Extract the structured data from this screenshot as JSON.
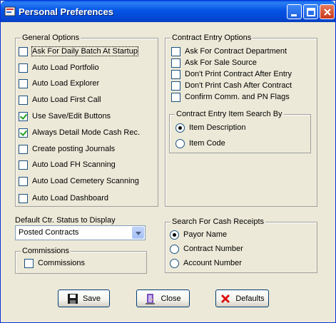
{
  "window": {
    "title": "Personal Preferences",
    "colors": {
      "titlebar": "#0554e4",
      "face": "#ece9d8"
    }
  },
  "general_options": {
    "title": "General Options",
    "items": [
      {
        "label": "Ask For Daily Batch At Startup",
        "checked": false
      },
      {
        "label": "Auto Load Portfolio",
        "checked": false
      },
      {
        "label": "Auto Load Explorer",
        "checked": false
      },
      {
        "label": "Auto Load First Call",
        "checked": false
      },
      {
        "label": "Use Save/Edit Buttons",
        "checked": true
      },
      {
        "label": "Always Detail Mode Cash Rec.",
        "checked": true
      },
      {
        "label": "Create posting Journals",
        "checked": false
      },
      {
        "label": "Auto Load FH Scanning",
        "checked": false
      },
      {
        "label": "Auto Load Cemetery Scanning",
        "checked": false
      },
      {
        "label": "Auto Load Dashboard",
        "checked": false
      }
    ]
  },
  "contract_entry": {
    "title": "Contract Entry Options",
    "items": [
      {
        "label": "Ask For Contract Department",
        "checked": false
      },
      {
        "label": "Ask For Sale Source",
        "checked": false
      },
      {
        "label": "Don't Print Contract After Entry",
        "checked": false
      },
      {
        "label": "Don't Print Cash After Contract",
        "checked": false
      },
      {
        "label": "Confirm Comm. and PN Flags",
        "checked": false
      }
    ],
    "search_by": {
      "title": "Contract Entry Item Search By",
      "options": [
        {
          "label": "Item Description",
          "selected": true
        },
        {
          "label": "Item Code",
          "selected": false
        }
      ]
    }
  },
  "default_status": {
    "label": "Default Ctr. Status to Display",
    "value": "Posted Contracts"
  },
  "commissions": {
    "title": "Commissions",
    "checkbox_label": "Commissions",
    "checked": false
  },
  "cash_receipts": {
    "title": "Search For Cash Receipts",
    "options": [
      {
        "label": "Payor Name",
        "selected": true
      },
      {
        "label": "Contract Number",
        "selected": false
      },
      {
        "label": "Account Number",
        "selected": false
      }
    ]
  },
  "buttons": {
    "save": "Save",
    "close": "Close",
    "defaults": "Defaults"
  }
}
